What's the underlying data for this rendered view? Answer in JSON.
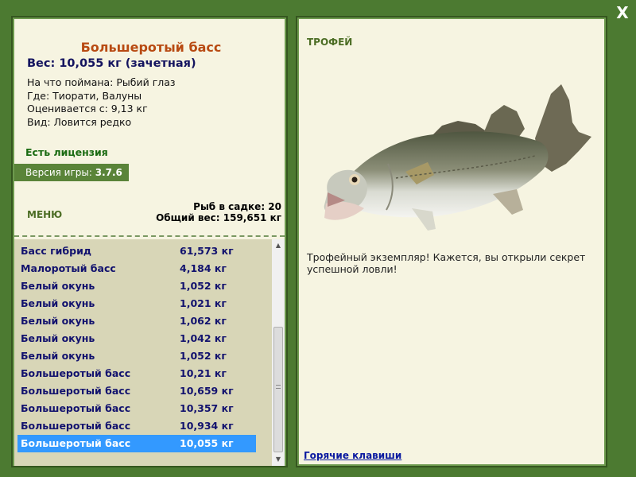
{
  "close_label": "X",
  "fish": {
    "title": "Большеротый басс",
    "weight": "Вес: 10,055 кг (зачетная)",
    "caught_on": "На что поймана: Рыбий глаз",
    "where": "Где: Тиорати, Валуны",
    "valued_from": "Оценивается с: 9,13 кг",
    "kind": "Вид: Ловится редко"
  },
  "license": "Есть лицензия",
  "version": {
    "label": "Версия игры:",
    "value": "3.7.6"
  },
  "menu_label": "МЕНЮ",
  "cage": {
    "count": "Рыб в садке: 20",
    "total": "Общий вес: 159,651 кг"
  },
  "catch_list": [
    {
      "name": "Басс гибрид",
      "weight": "61,573 кг"
    },
    {
      "name": "Малоротый басс",
      "weight": "4,184 кг"
    },
    {
      "name": "Белый окунь",
      "weight": "1,052 кг"
    },
    {
      "name": "Белый окунь",
      "weight": "1,021 кг"
    },
    {
      "name": "Белый окунь",
      "weight": "1,062 кг"
    },
    {
      "name": "Белый окунь",
      "weight": "1,042 кг"
    },
    {
      "name": "Белый окунь",
      "weight": "1,052 кг"
    },
    {
      "name": "Большеротый басс",
      "weight": "10,21 кг"
    },
    {
      "name": "Большеротый басс",
      "weight": "10,659 кг"
    },
    {
      "name": "Большеротый басс",
      "weight": "10,357 кг"
    },
    {
      "name": "Большеротый басс",
      "weight": "10,934 кг"
    },
    {
      "name": "Большеротый басс",
      "weight": "10,055 кг"
    }
  ],
  "selected_index": 11,
  "trophy": {
    "label": "ТРОФЕЙ",
    "text": "Трофейный экземпляр! Кажется, вы открыли секрет успешной ловли!"
  },
  "hotkeys_label": "Горячие клавиши",
  "colors": {
    "frame": "#4c7a31",
    "panel": "#f6f4e1",
    "list": "#d8d6b7",
    "selected": "#3399ff",
    "title": "#b84a12"
  },
  "icons": {
    "close": "close-icon",
    "scroll_up": "chevron-up-icon",
    "scroll_down": "chevron-down-icon"
  }
}
